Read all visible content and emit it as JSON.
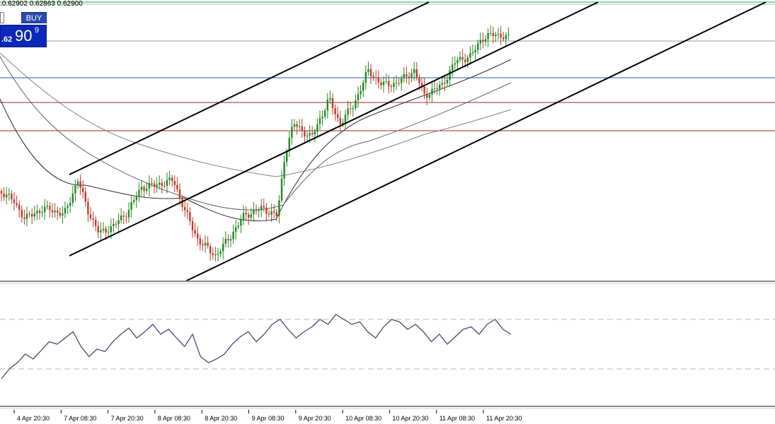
{
  "ohlc_readout": ".0.62902 0.62863 0.62900",
  "trade_panel": {
    "buy_label": "BUY",
    "price_small": ".62",
    "price_big": "90",
    "price_sup": "9"
  },
  "colors": {
    "candle_up": "#1f8a1f",
    "candle_down": "#c0392b",
    "channel": "#000000",
    "ma_fast": "#3a2a3a",
    "ma_mid": "#6b5a6b",
    "ma_slow": "#8a7a8a",
    "hline_blue": "#1f5fa8",
    "hline_red": "#a8261f",
    "hline_grey": "#9a9a9a",
    "hline_top_green": "#3aa05a",
    "oscillator": "#4a4a78",
    "osc_level": "#b7b7d6"
  },
  "chart_data": [
    {
      "type": "candlestick",
      "title": "",
      "x_tick_labels": [
        "4 Apr 20:30",
        "7 Apr 08:30",
        "7 Apr 20:30",
        "8 Apr 08:30",
        "8 Apr 20:30",
        "9 Apr 08:30",
        "9 Apr 20:30",
        "10 Apr 08:30",
        "10 Apr 20:30",
        "11 Apr 08:30",
        "11 Apr 20:30"
      ],
      "last_close": 0.629,
      "trendline_channel": "ascending, 3 parallel lines",
      "horizontal_levels": [
        {
          "color": "grey",
          "note": "current price level"
        },
        {
          "color": "blue"
        },
        {
          "color": "red"
        },
        {
          "color": "red"
        }
      ],
      "moving_averages": 3,
      "grid": false
    },
    {
      "type": "line",
      "title": "",
      "series": [
        {
          "values": [
            22,
            30,
            35,
            42,
            38,
            45,
            52,
            50,
            55,
            60,
            48,
            40,
            46,
            44,
            52,
            58,
            63,
            55,
            60,
            66,
            58,
            62,
            55,
            48,
            58,
            40,
            35,
            38,
            42,
            50,
            56,
            60,
            52,
            58,
            66,
            70,
            62,
            55,
            60,
            64,
            70,
            66,
            74,
            70,
            66,
            68,
            60,
            55,
            64,
            70,
            68,
            62,
            66,
            60,
            52,
            58,
            50,
            56,
            62,
            64,
            58,
            66,
            70,
            62,
            58
          ]
        }
      ],
      "levels": [
        30,
        70
      ],
      "ylim": [
        0,
        100
      ]
    }
  ]
}
